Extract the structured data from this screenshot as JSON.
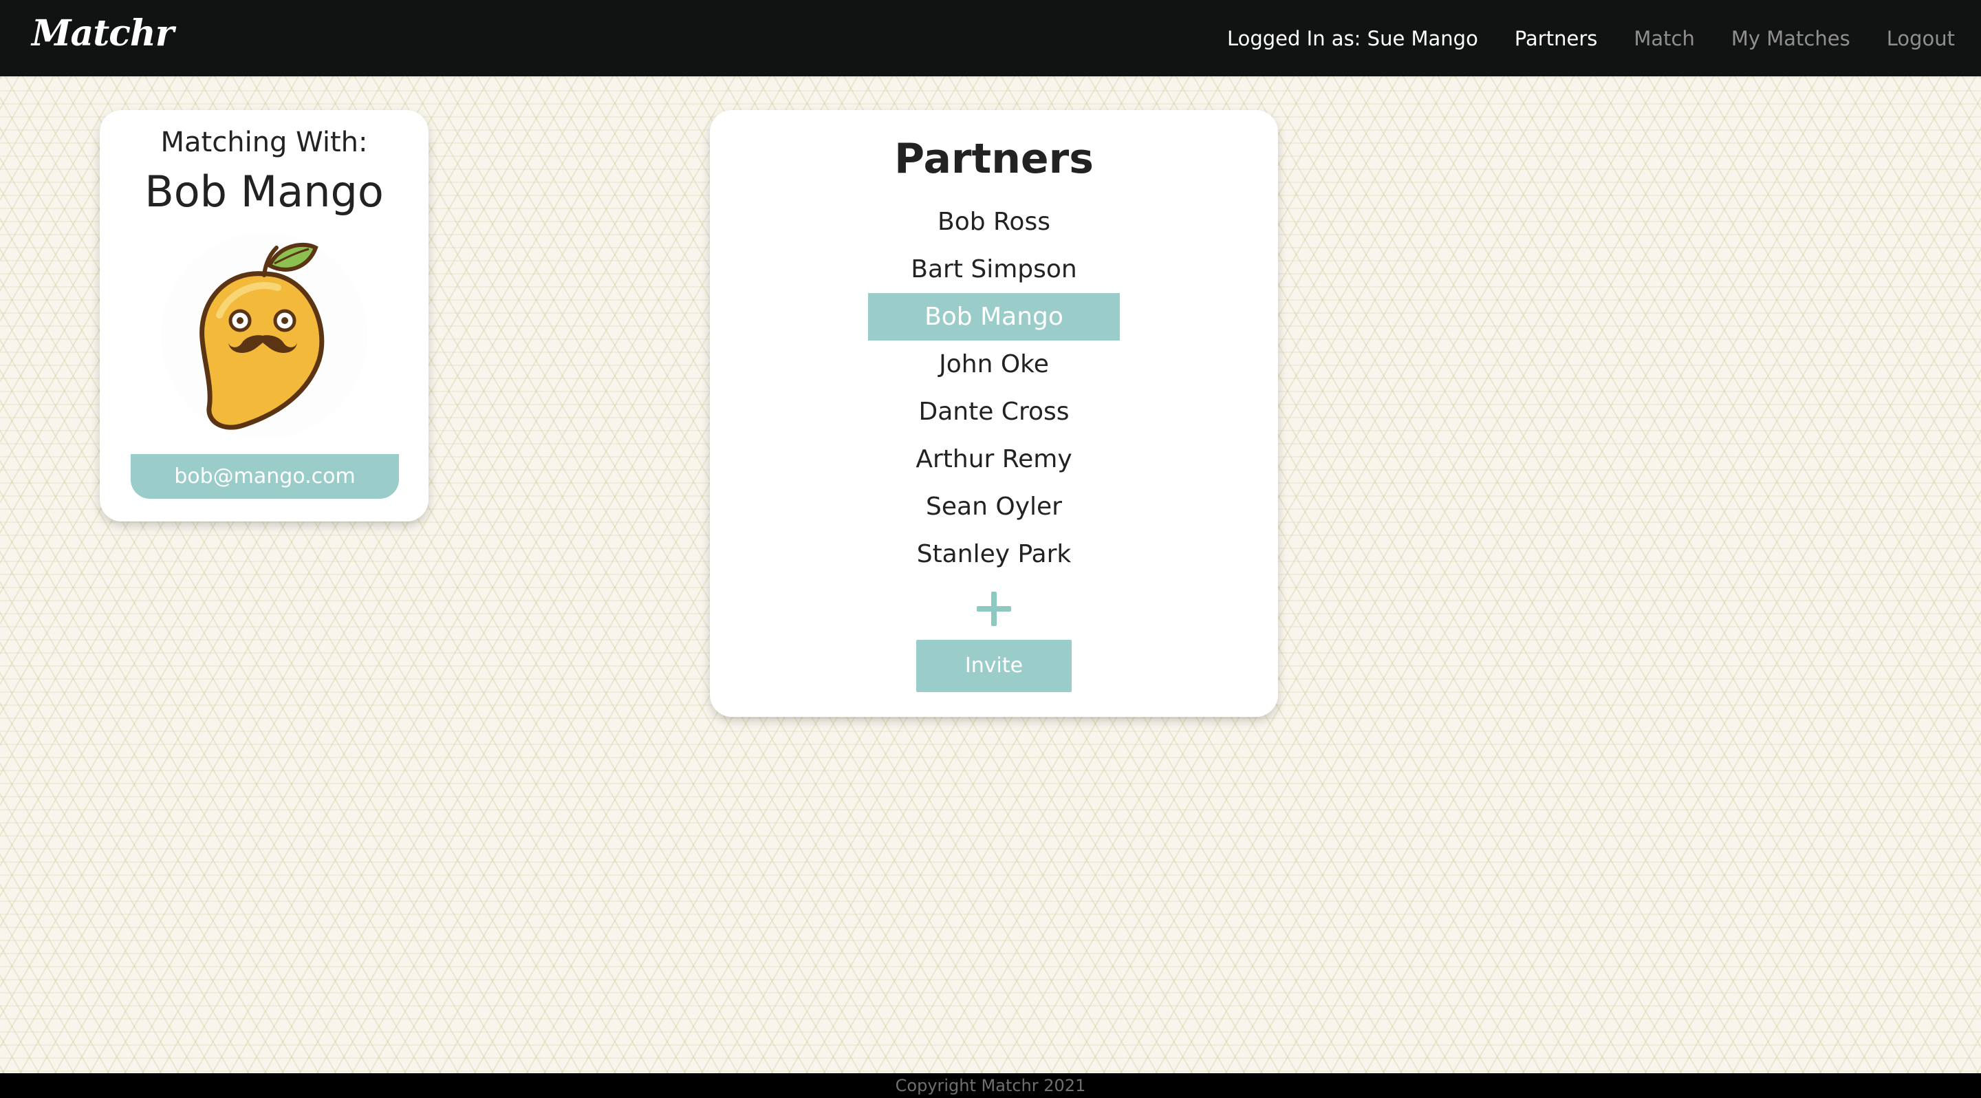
{
  "navbar": {
    "brand": "Matchr",
    "logged_in": "Logged In as: Sue Mango",
    "links": {
      "partners": "Partners",
      "match": "Match",
      "my_matches": "My Matches",
      "logout": "Logout"
    }
  },
  "profile": {
    "label": "Matching With:",
    "name": "Bob Mango",
    "email": "bob@mango.com",
    "avatar_icon": "mango-mustache-icon"
  },
  "partners": {
    "title": "Partners",
    "items": [
      {
        "name": "Bob Ross",
        "selected": false
      },
      {
        "name": "Bart Simpson",
        "selected": false
      },
      {
        "name": "Bob Mango",
        "selected": true
      },
      {
        "name": "John Oke",
        "selected": false
      },
      {
        "name": "Dante Cross",
        "selected": false
      },
      {
        "name": "Arthur Remy",
        "selected": false
      },
      {
        "name": "Sean Oyler",
        "selected": false
      },
      {
        "name": "Stanley Park",
        "selected": false
      }
    ],
    "add_icon": "plus-icon",
    "invite_label": "Invite"
  },
  "footer": {
    "copyright": "Copyright Matchr 2021"
  },
  "colors": {
    "accent": "#9accc9",
    "navbar": "#111312",
    "background": "#f8f6ec"
  }
}
